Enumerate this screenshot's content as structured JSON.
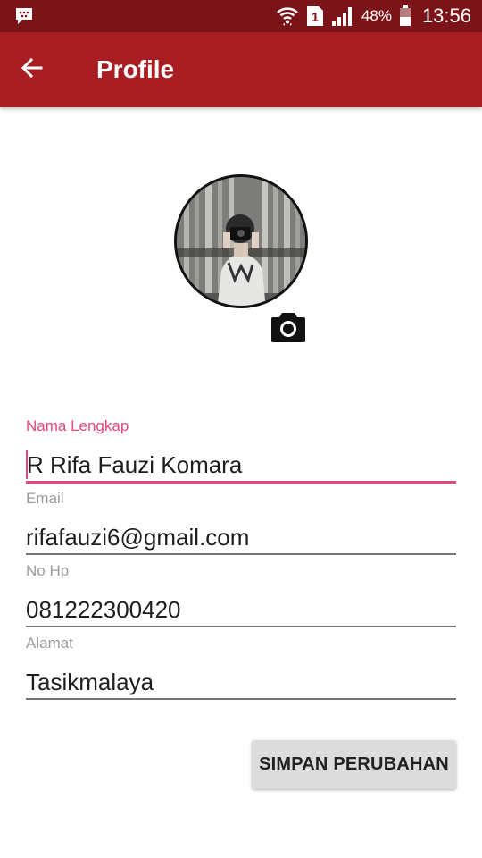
{
  "status_bar": {
    "sim_slot": "1",
    "battery": "48%",
    "time": "13:56",
    "icons": [
      "bbm-icon",
      "wifi-icon",
      "sim-icon",
      "signal-icon",
      "battery-icon"
    ]
  },
  "app_bar": {
    "title": "Profile",
    "color": "#a71d21",
    "back_icon": "arrow-back-icon"
  },
  "profile": {
    "avatar": "profile-photo",
    "camera_icon": "camera-icon"
  },
  "form": {
    "accent": "#e4477d",
    "fields": [
      {
        "label": "Nama Lengkap",
        "value": "R Rifa Fauzi Komara"
      },
      {
        "label": "Email",
        "value": "rifafauzi6@gmail.com"
      },
      {
        "label": "No Hp",
        "value": "081222300420"
      },
      {
        "label": "Alamat",
        "value": "Tasikmalaya"
      }
    ],
    "save_label": "SIMPAN PERUBAHAN"
  }
}
